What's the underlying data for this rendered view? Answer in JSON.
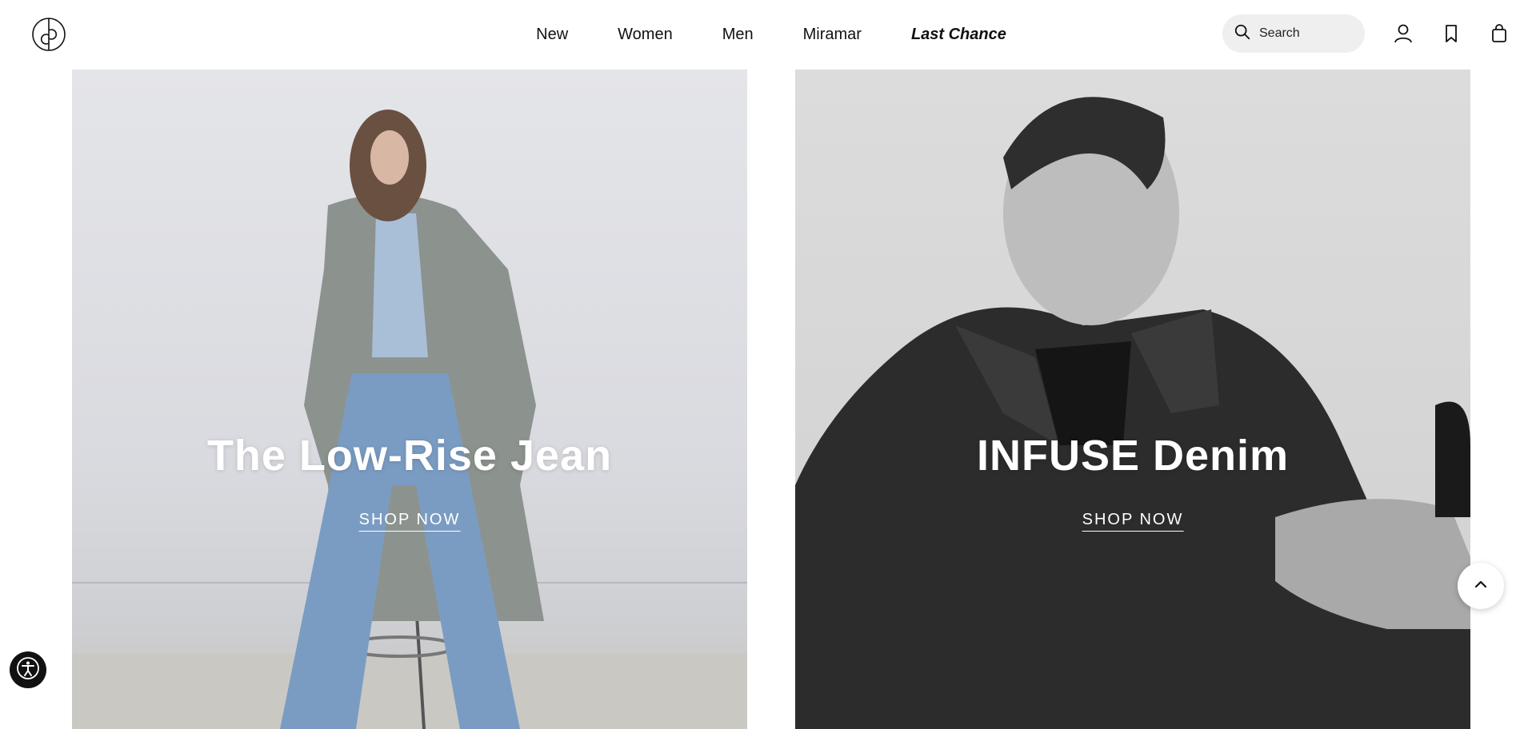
{
  "header": {
    "logo_icon": "brand-logo-icon",
    "nav": [
      {
        "label": "New"
      },
      {
        "label": "Women"
      },
      {
        "label": "Men"
      },
      {
        "label": "Miramar"
      },
      {
        "label": "Last Chance",
        "italic": true
      }
    ],
    "search": {
      "placeholder": "Search",
      "icon": "search-icon"
    },
    "icons": [
      "account-icon",
      "bookmark-icon",
      "shopping-bag-icon"
    ]
  },
  "hero": [
    {
      "title": "The Low-Rise Jean",
      "cta": "SHOP NOW",
      "image": "woman-in-plaid-coat-and-light-jeans-on-stool"
    },
    {
      "title": "INFUSE Denim",
      "cta": "SHOP NOW",
      "image": "man-in-black-denim-jacket-black-and-white"
    }
  ],
  "floating": {
    "scroll_top_icon": "chevron-up-icon",
    "accessibility_icon": "accessibility-icon"
  },
  "colors": {
    "text": "#111111",
    "search_bg": "#efefef",
    "hero_text": "#ffffff"
  }
}
